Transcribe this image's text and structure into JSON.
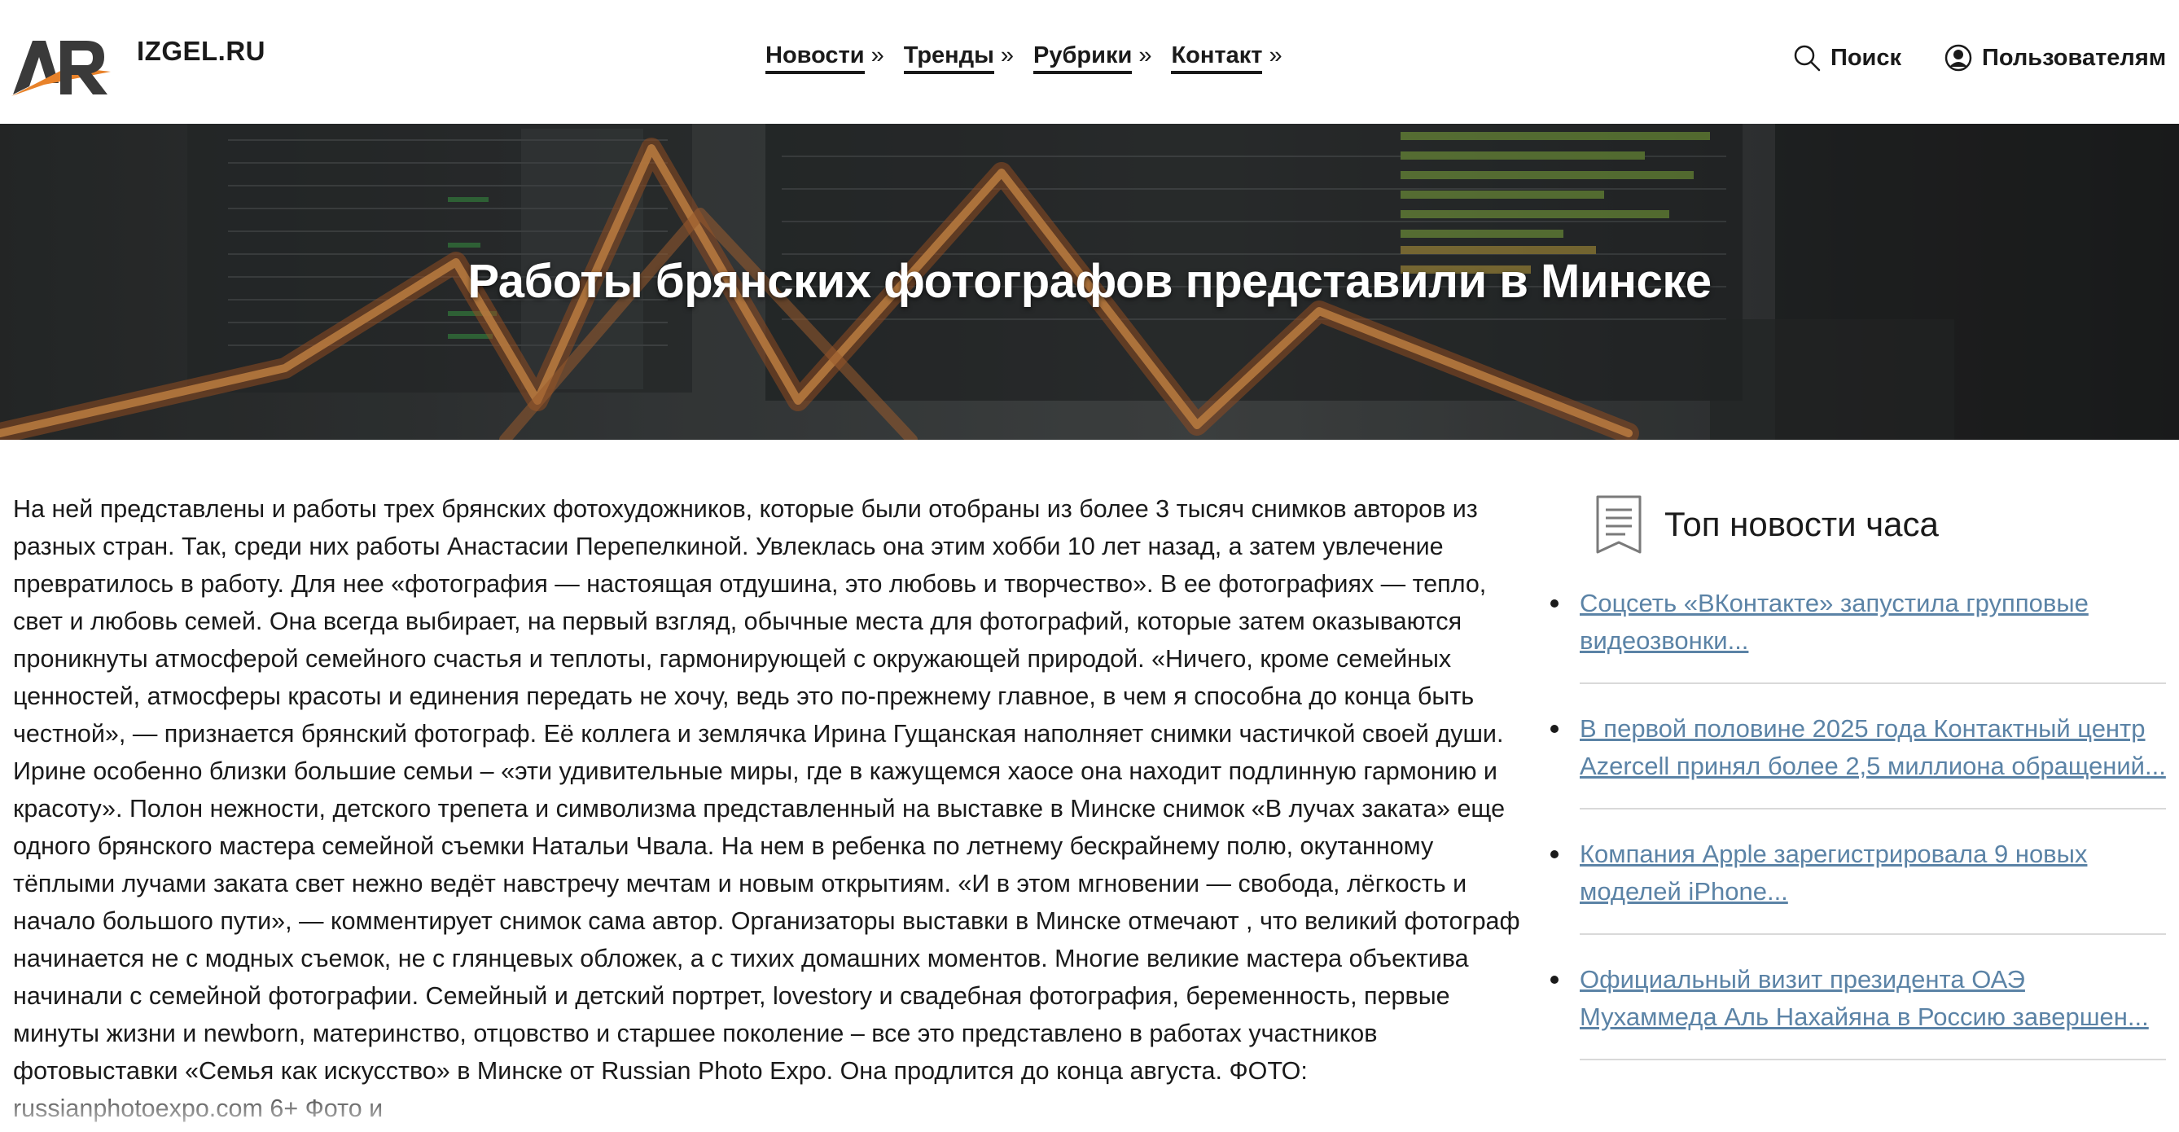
{
  "header": {
    "site_name": "IZGEL.RU",
    "logo_text": "AR",
    "nav": [
      {
        "label": "Новости",
        "arrow": "»"
      },
      {
        "label": "Тренды",
        "arrow": "»"
      },
      {
        "label": "Рубрики",
        "arrow": "»"
      },
      {
        "label": "Контакт",
        "arrow": "»"
      }
    ],
    "search_label": "Поиск",
    "users_label": "Пользователям"
  },
  "hero": {
    "title": "Работы брянских фотографов представили в Минске"
  },
  "article": {
    "body": "На ней представлены и работы трех брянских фотохудожников, которые были отобраны из более 3 тысяч снимков авторов из разных стран. Так, среди них работы Анастасии Перепелкиной. Увлеклась она этим хобби 10 лет назад, а затем увлечение превратилось в работу. Для нее «фотография — настоящая отдушина, это любовь и творчество». В ее фотографиях — тепло, свет и любовь семей. Она всегда выбирает, на первый взгляд, обычные места для фотографий, которые затем оказываются проникнуты атмосферой семейного счастья и теплоты, гармонирующей с окружающей природой. «Ничего, кроме семейных ценностей, атмосферы красоты и единения передать не хочу, ведь это по-прежнему главное, в чем я способна до конца быть честной», — признается брянский фотограф. Её коллега и землячка Ирина Гущанская наполняет снимки частичкой своей души. Ирине особенно близки большие семьи – «эти удивительные миры, где в кажущемся хаосе она находит подлинную гармонию и красоту». Полон нежности, детского трепета и символизма представленный на выставке в Минске снимок «В лучах заката» еще одного брянского мастера семейной съемки Натальи Чвала. На нем в ребенка по летнему бескрайнему полю, окутанному тёплыми лучами заката свет нежно ведёт навстречу мечтам и новым открытиям. «И в этом мгновении — свобода, лёгкость и начало большого пути», — комментирует снимок сама автор. Организаторы выставки в Минске отмечают , что великий фотограф начинается не с модных съемок, не с глянцевых обложек, а с тихих домашних моментов. Многие великие мастера объектива начинали с семейной фотографии. Семейный и детский портрет, lovestory и свадебная фотография, беременность, первые минуты жизни и newborn, материнство, отцовство и старшее поколение – все это представлено в работах участников фотовыставки «Семья как искусство» в Минске от Russian Photo Expo. Она продлится до конца августа. ФОТО: russianphotoexpo.com 6+ Фото и"
  },
  "sidebar": {
    "title": "Топ новости часа",
    "items": [
      {
        "text": "Соцсеть «ВКонтакте» запустила групповые видеозвонки..."
      },
      {
        "text": "В первой половине 2025 года Контактный центр Azercell принял более 2,5 миллиона обращений..."
      },
      {
        "text": "Компания Apple зарегистрировала 9 новых моделей iPhone..."
      },
      {
        "text": "Официальный визит президента ОАЭ Мухаммеда Аль Нахайяна в Россию завершен..."
      }
    ]
  },
  "icons": {
    "search": "search-icon",
    "user": "user-icon",
    "news": "document-icon"
  },
  "colors": {
    "link": "#5b83a6",
    "text": "#1a1a1a",
    "logo_orange": "#e8822a"
  }
}
